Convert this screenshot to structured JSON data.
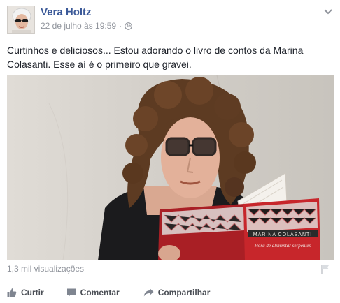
{
  "post": {
    "author": "Vera Holtz",
    "timestamp": "22 de julho às 19:59",
    "separator": "·",
    "privacy_icon": "globe-icon",
    "text": "Curtinhos e deliciosos... Estou adorando o livro de contos da Marina Colasanti. Esse aí é o primeiro que gravei."
  },
  "video": {
    "book_author": "MARINA COLASANTI",
    "book_title": "Hora de alimentar serpentes",
    "accent_color": "#c7262b"
  },
  "stats": {
    "views": "1,3 mil visualizações"
  },
  "actions": [
    {
      "label": "Curtir",
      "icon": "thumbs-up-icon"
    },
    {
      "label": "Comentar",
      "icon": "comment-icon"
    },
    {
      "label": "Compartilhar",
      "icon": "share-icon"
    }
  ],
  "colors": {
    "link": "#3b5998",
    "meta": "#90949c",
    "action": "#4b4f56"
  }
}
